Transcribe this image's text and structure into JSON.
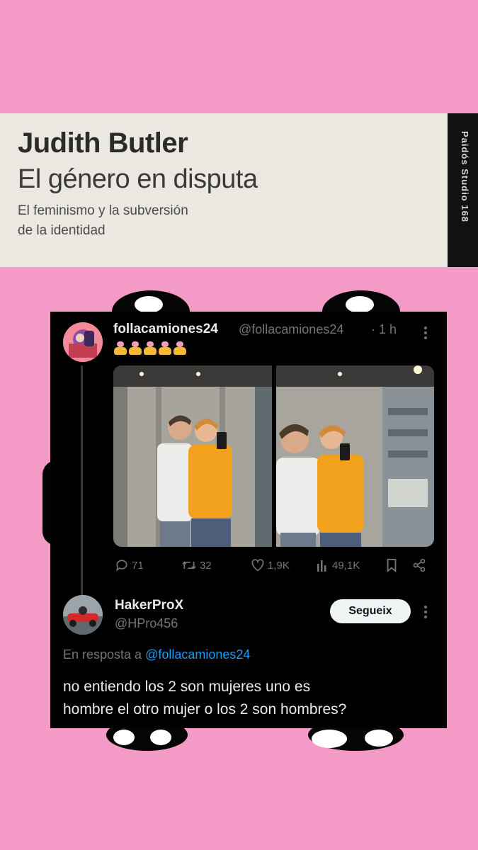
{
  "book": {
    "author": "Judith Butler",
    "title": "El género en disputa",
    "subtitle_line1": "El feminismo y la subversión",
    "subtitle_line2": "de la identidad",
    "spine_text": "Paidós Studio 168"
  },
  "tweet": {
    "display_name": "follacamiones24",
    "handle": "@follacamiones24",
    "time": "· 1 h",
    "emoji_count": 5,
    "actions": {
      "replies": "71",
      "retweets": "32",
      "likes": "1,9K",
      "views": "49,1K"
    }
  },
  "reply": {
    "display_name": "HakerProX",
    "handle": "@HPro456",
    "follow_label": "Segueix",
    "reply_to_prefix": "En resposta a",
    "reply_to_handle": "@follacamiones24",
    "text_line1": "no entiendo los 2 son mujeres uno es",
    "text_line2": "hombre el otro mujer o los 2 son hombres?"
  },
  "colors": {
    "background": "#f39bc6",
    "tweet_bg": "#000000",
    "link": "#1d9bf0",
    "muted": "#71767b"
  }
}
